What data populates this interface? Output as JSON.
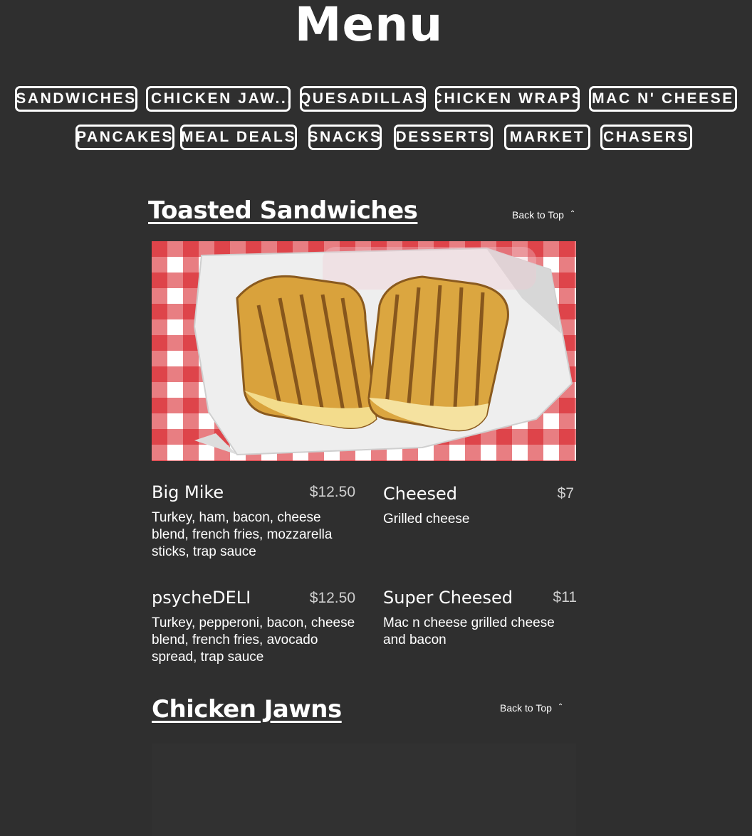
{
  "page": {
    "title": "Menu",
    "background": "#2f2f2f"
  },
  "nav": {
    "row1": [
      "SANDWICHES",
      "CHICKEN JAW...",
      "QUESADILLAS",
      "CHICKEN WRAPS",
      "MAC N' CHEESE"
    ],
    "row2": [
      "PANCAKES",
      "MEAL DEALS",
      "SNACKS",
      "DESSERTS",
      "MARKET",
      "CHASERS"
    ]
  },
  "sections": [
    {
      "title": "Toasted Sandwiches",
      "back_to_top": "Back to Top",
      "items": [
        {
          "name": "Big Mike",
          "price": "$12.50",
          "description": "Turkey, ham, bacon, cheese blend, french fries, mozzarella sticks, trap sauce"
        },
        {
          "name": "Cheesed",
          "price": "$7",
          "description": "Grilled cheese"
        },
        {
          "name": "psycheDELI",
          "price": "$12.50",
          "description": "Turkey, pepperoni, bacon, cheese blend, french fries, avocado spread, trap sauce"
        },
        {
          "name": "Super Cheesed",
          "price": "$11",
          "description": "Mac n cheese grilled cheese and bacon"
        }
      ]
    },
    {
      "title": "Chicken Jawns",
      "back_to_top": "Back to Top"
    }
  ]
}
